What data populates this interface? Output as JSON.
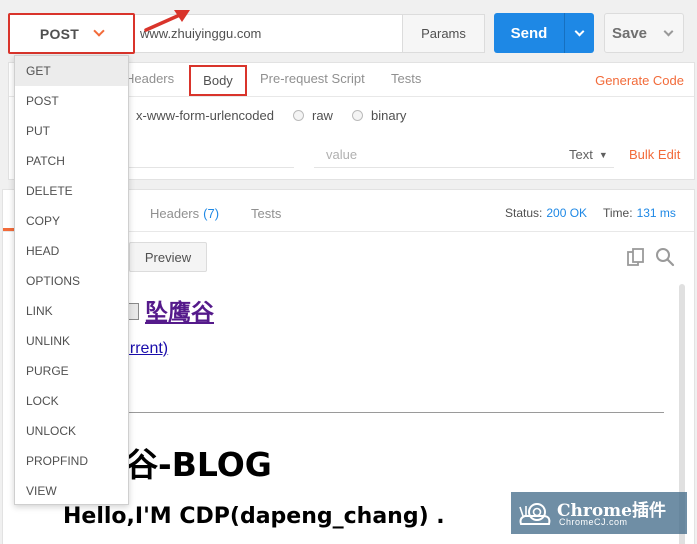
{
  "request": {
    "method": "POST",
    "url": "www.zhuiyinggu.com",
    "params_label": "Params",
    "send_label": "Send",
    "save_label": "Save"
  },
  "method_menu": {
    "items": [
      "GET",
      "POST",
      "PUT",
      "PATCH",
      "DELETE",
      "COPY",
      "HEAD",
      "OPTIONS",
      "LINK",
      "UNLINK",
      "PURGE",
      "LOCK",
      "UNLOCK",
      "PROPFIND",
      "VIEW"
    ]
  },
  "request_tabs": {
    "headers": "Headers",
    "body": "Body",
    "prerequest": "Pre-request Script",
    "tests": "Tests",
    "generate_code": "Generate Code"
  },
  "body_options": {
    "urlencoded": "x-www-form-urlencoded",
    "raw": "raw",
    "binary": "binary"
  },
  "kv": {
    "value_placeholder": "value",
    "type_label": "Text",
    "bulk_edit": "Bulk Edit"
  },
  "response": {
    "headers_label": "Headers",
    "headers_count": "(7)",
    "tests_label": "Tests",
    "status_label": "Status:",
    "status_value": "200 OK",
    "time_label": "Time:",
    "time_value": "131 ms",
    "preview_label": "Preview"
  },
  "preview": {
    "site_link": "坠鹰谷",
    "current_link": "urrent)",
    "blog_title": "谷-BLOG",
    "hello": "Hello,I'M CDP(dapeng_chang) ."
  },
  "watermark": {
    "main": "Chrome插件",
    "sub": "ChromeCJ.com"
  },
  "colors": {
    "accent_red": "#d9342b",
    "accent_orange": "#f26b3a",
    "send_blue": "#1e88e5"
  }
}
